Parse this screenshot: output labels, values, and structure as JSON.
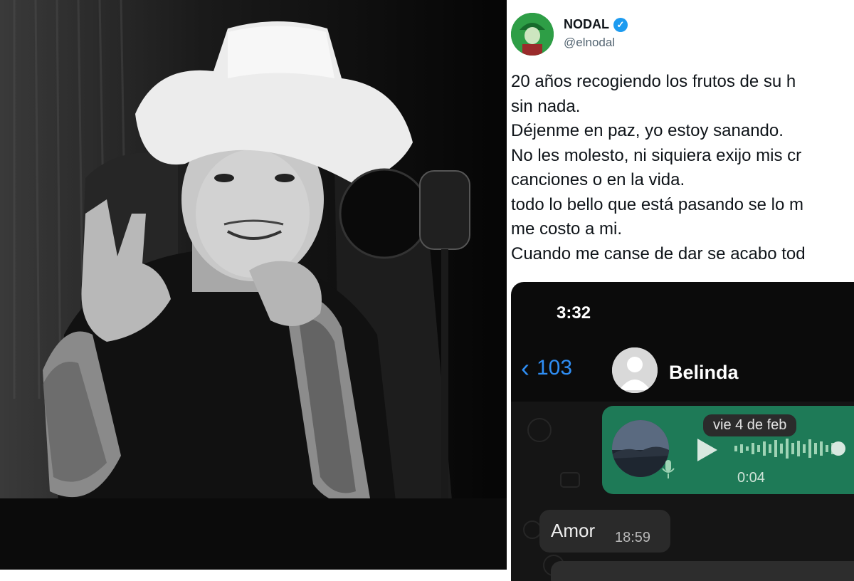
{
  "tweet": {
    "display_name": "NODAL",
    "handle": "@elnodal",
    "verified_mark": "✓",
    "lines": [
      "20 años recogiendo los frutos de su h",
      "sin nada.",
      "Déjenme en paz, yo estoy sanando.",
      "No les molesto, ni siquiera exijo mis cr",
      "canciones o en la vida.",
      "todo lo bello que está pasando se lo m",
      "me costo a mi.",
      "Cuando me canse de dar se acabo tod"
    ]
  },
  "chat": {
    "status_time": "3:32",
    "back_chevron": "‹",
    "back_count": "103",
    "contact_name": "Belinda",
    "date_separator": "vie 4 de feb",
    "voice_note_duration": "0:04",
    "message_text": "Amor",
    "message_time": "18:59",
    "colors": {
      "accent_blue": "#2f8ef4",
      "voice_bubble": "#1e7a57"
    }
  }
}
